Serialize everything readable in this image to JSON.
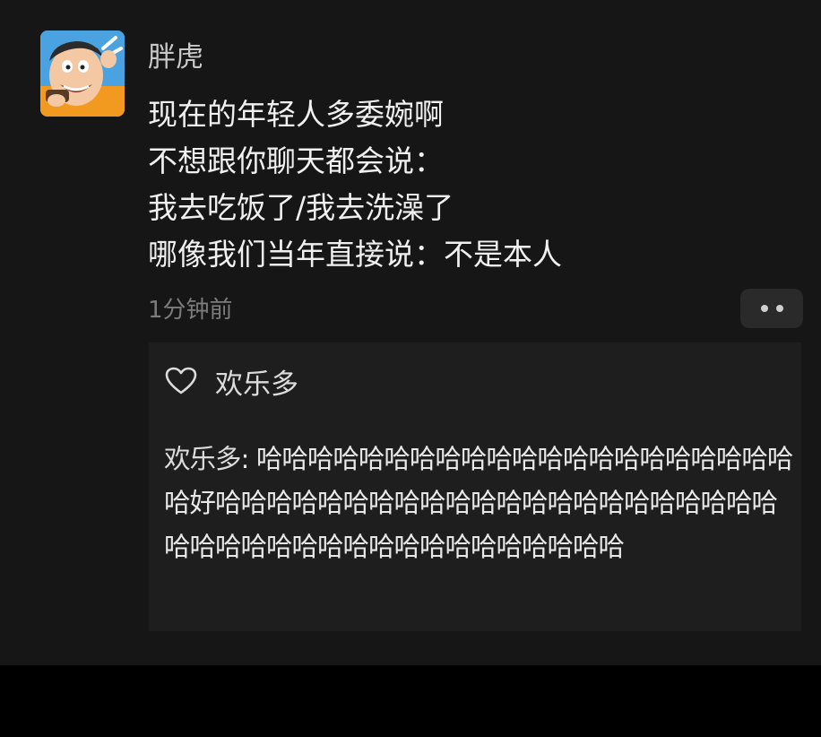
{
  "post": {
    "username": "胖虎",
    "lines": [
      "现在的年轻人多委婉啊",
      "不想跟你聊天都会说：",
      "我去吃饭了/我去洗澡了",
      "哪像我们当年直接说：不是本人"
    ],
    "timestamp": "1分钟前",
    "more_icon": "more-dots-icon"
  },
  "likes": {
    "icon": "heart-outline-icon",
    "names": "欢乐多"
  },
  "comments": [
    {
      "author": "欢乐多",
      "separator": ": ",
      "text": "哈哈哈哈哈哈哈哈哈哈哈哈哈哈哈哈哈哈哈哈哈哈好哈哈哈哈哈哈哈哈哈哈哈哈哈哈哈哈哈哈哈哈哈哈哈哈哈哈哈哈哈哈哈哈哈哈哈哈哈哈哈哈"
    }
  ],
  "colors": {
    "background": "#161616",
    "panel": "#1e1e1e",
    "text": "#f0f0f0",
    "muted": "#7c7c7c"
  }
}
